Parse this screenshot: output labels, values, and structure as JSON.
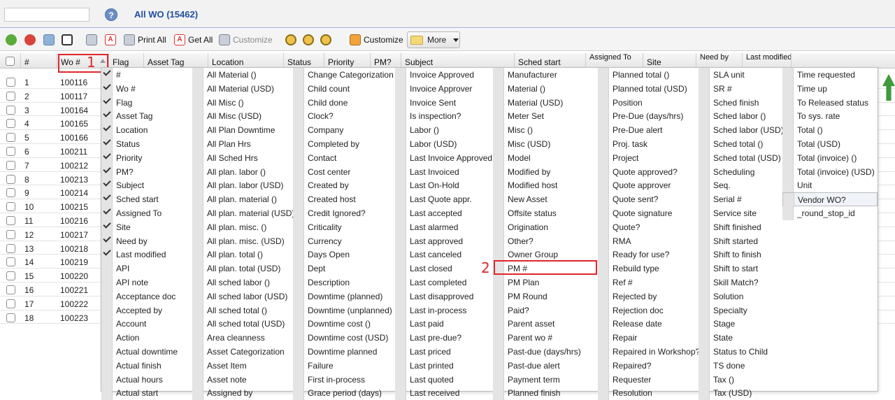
{
  "topbar": {
    "title": "All WO (15462)",
    "help_glyph": "?"
  },
  "toolbar": {
    "print_all": "Print All",
    "get_all": "Get All",
    "customize_disabled": "Customize",
    "customize": "Customize",
    "more": "More"
  },
  "header": {
    "cols": [
      "#",
      "Wo #",
      "Flag",
      "Asset Tag",
      "Location",
      "Status",
      "Priority",
      "PM?",
      "Subject",
      "Sched start",
      "Assigned To",
      "Site",
      "Need by",
      "Last modified"
    ]
  },
  "rows": [
    {
      "num": "1",
      "wo": "100116"
    },
    {
      "num": "2",
      "wo": "100117"
    },
    {
      "num": "3",
      "wo": "100164"
    },
    {
      "num": "4",
      "wo": "100165"
    },
    {
      "num": "5",
      "wo": "100166"
    },
    {
      "num": "6",
      "wo": "100211"
    },
    {
      "num": "7",
      "wo": "100212"
    },
    {
      "num": "8",
      "wo": "100213"
    },
    {
      "num": "9",
      "wo": "100214"
    },
    {
      "num": "10",
      "wo": "100215"
    },
    {
      "num": "11",
      "wo": "100216"
    },
    {
      "num": "12",
      "wo": "100217"
    },
    {
      "num": "13",
      "wo": "100218"
    },
    {
      "num": "14",
      "wo": "100219"
    },
    {
      "num": "15",
      "wo": "100220"
    },
    {
      "num": "16",
      "wo": "100221"
    },
    {
      "num": "17",
      "wo": "100222"
    },
    {
      "num": "18",
      "wo": "100223"
    }
  ],
  "menu": {
    "col1": [
      "#",
      "Wo #",
      "Flag",
      "Asset Tag",
      "Location",
      "Status",
      "Priority",
      "PM?",
      "Subject",
      "Sched start",
      "Assigned To",
      "Site",
      "Need by",
      "Last modified",
      "API",
      "API note",
      "Acceptance doc",
      "Accepted by",
      "Account",
      "Action",
      "Actual downtime",
      "Actual finish",
      "Actual hours",
      "Actual start"
    ],
    "col1_checked": 14,
    "col2": [
      "All Material ()",
      "All Material (USD)",
      "All Misc ()",
      "All Misc (USD)",
      "All Plan Downtime",
      "All Plan Hrs",
      "All Sched Hrs",
      "All plan. labor ()",
      "All plan. labor (USD)",
      "All plan. material ()",
      "All plan. material (USD)",
      "All plan. misc. ()",
      "All plan. misc. (USD)",
      "All plan. total ()",
      "All plan. total (USD)",
      "All sched labor ()",
      "All sched labor (USD)",
      "All sched total ()",
      "All sched total (USD)",
      "Area cleanness",
      "Asset Categorization",
      "Asset Item",
      "Asset note",
      "Assigned by"
    ],
    "col3": [
      "Change Categorization",
      "Child count",
      "Child done",
      "Clock?",
      "Company",
      "Completed by",
      "Contact",
      "Cost center",
      "Created by",
      "Created host",
      "Credit Ignored?",
      "Criticality",
      "Currency",
      "Days Open",
      "Dept",
      "Description",
      "Downtime (planned)",
      "Downtime (unplanned)",
      "Downtime cost ()",
      "Downtime cost (USD)",
      "Downtime planned",
      "Failure",
      "First in-process",
      "Grace period (days)"
    ],
    "col4": [
      "Invoice Approved",
      "Invoice Approver",
      "Invoice Sent",
      "Is inspection?",
      "Labor ()",
      "Labor (USD)",
      "Last Invoice Approved",
      "Last Invoiced",
      "Last On-Hold",
      "Last Quote appr.",
      "Last accepted",
      "Last alarmed",
      "Last approved",
      "Last canceled",
      "Last closed",
      "Last completed",
      "Last disapproved",
      "Last in-process",
      "Last paid",
      "Last pre-due?",
      "Last priced",
      "Last printed",
      "Last quoted",
      "Last received"
    ],
    "col5": [
      "Manufacturer",
      "Material ()",
      "Material (USD)",
      "Meter Set",
      "Misc ()",
      "Misc (USD)",
      "Model",
      "Modified by",
      "Modified host",
      "New Asset",
      "Offsite status",
      "Origination",
      "Other?",
      "Owner Group",
      "PM #",
      "PM Plan",
      "PM Round",
      "Paid?",
      "Parent asset",
      "Parent wo #",
      "Past-due (days/hrs)",
      "Past-due alert",
      "Payment term",
      "Planned finish"
    ],
    "col6": [
      "Planned total ()",
      "Planned total (USD)",
      "Position",
      "Pre-Due (days/hrs)",
      "Pre-Due alert",
      "Proj. task",
      "Project",
      "Quote approved?",
      "Quote approver",
      "Quote sent?",
      "Quote signature",
      "Quote?",
      "RMA",
      "Ready for use?",
      "Rebuild type",
      "Ref #",
      "Rejected by",
      "Rejection doc",
      "Release date",
      "Repair",
      "Repaired in Workshop?",
      "Repaired?",
      "Requester",
      "Resolution"
    ],
    "col7": [
      "SLA unit",
      "SR #",
      "Sched finish",
      "Sched labor ()",
      "Sched labor (USD)",
      "Sched total ()",
      "Sched total (USD)",
      "Scheduling",
      "Seq.",
      "Serial #",
      "Service site",
      "Shift finished",
      "Shift started",
      "Shift to finish",
      "Shift to start",
      "Skill Match?",
      "Solution",
      "Specialty",
      "Stage",
      "State",
      "Status to Child",
      "TS done",
      "Tax ()",
      "Tax (USD)"
    ],
    "col8": [
      "Time requested",
      "Time up",
      "To Released status",
      "To sys. rate",
      "Total ()",
      "Total (USD)",
      "Total (invoice) ()",
      "Total (invoice) (USD)",
      "Unit",
      "Vendor WO?",
      "_round_stop_id"
    ]
  },
  "annotations": {
    "one": "1",
    "two": "2"
  }
}
